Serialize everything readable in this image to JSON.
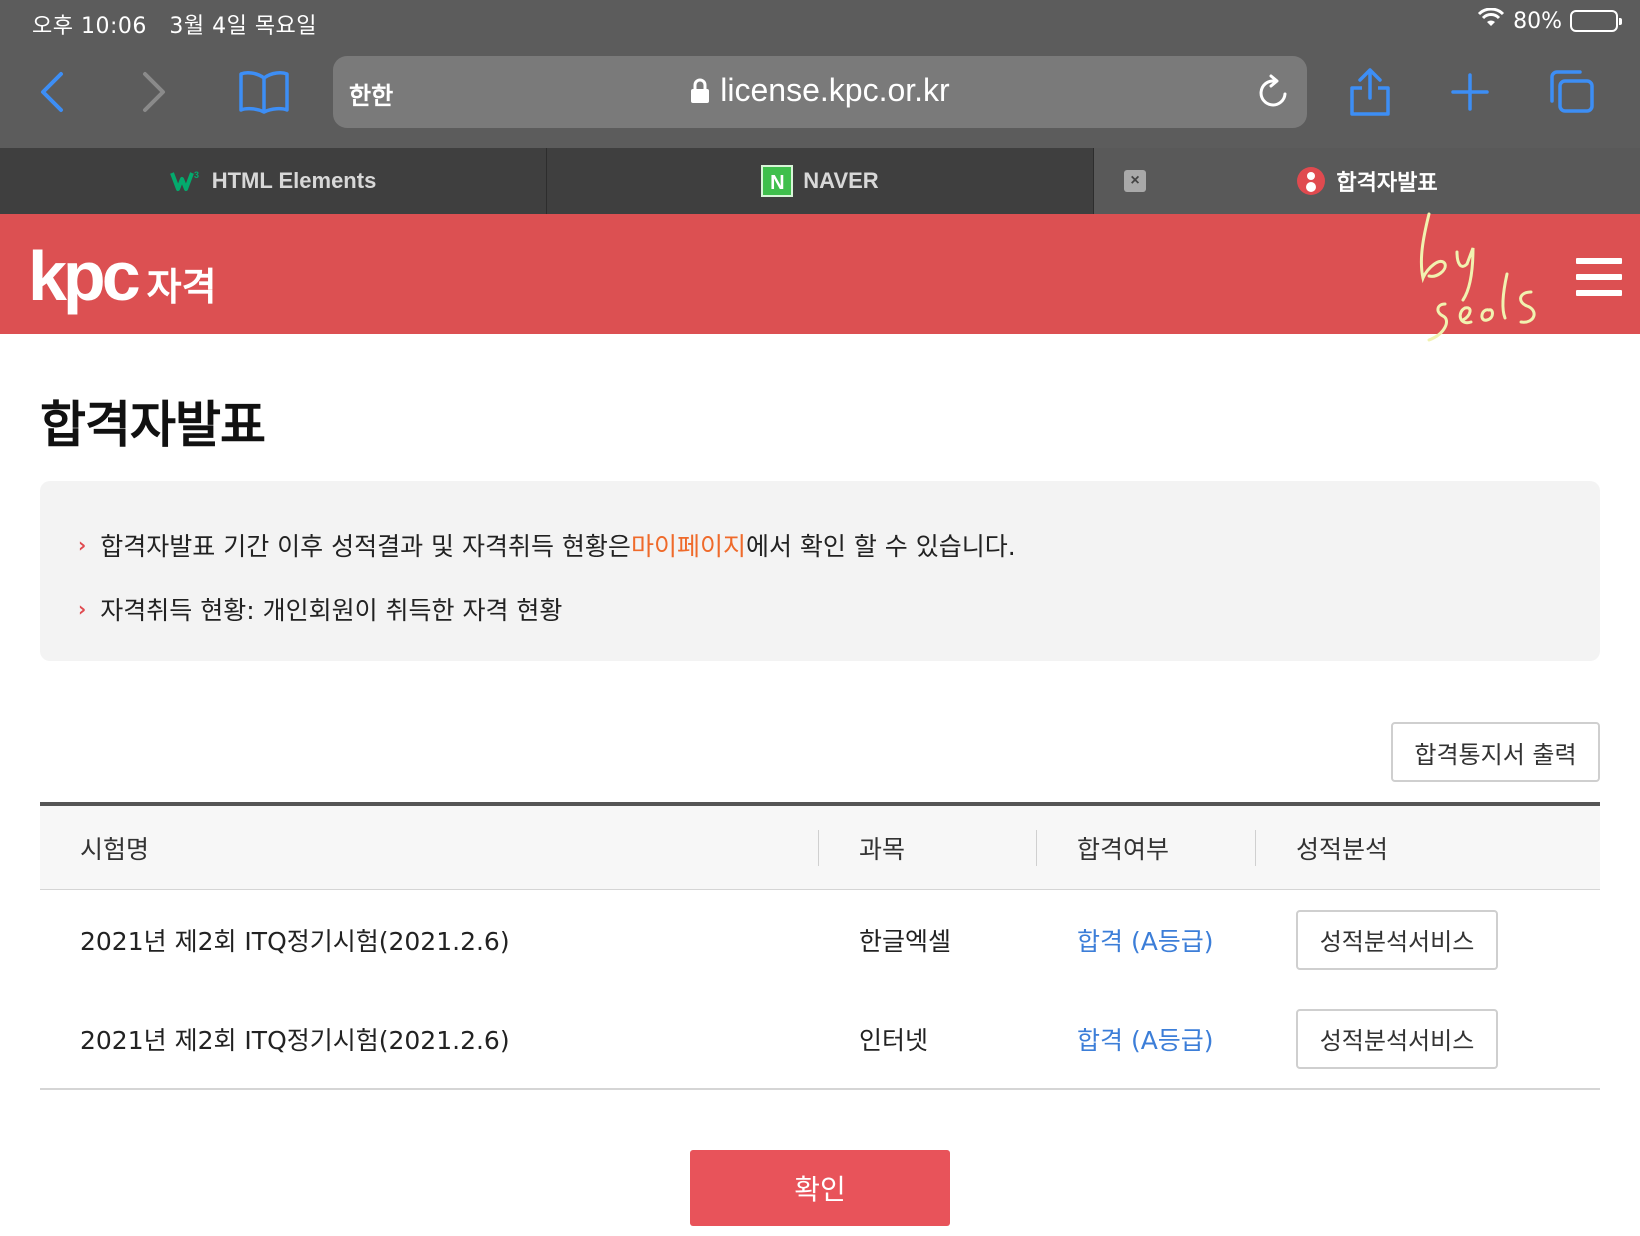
{
  "status_bar": {
    "time": "오후 10:06",
    "date": "3월 4일 목요일",
    "battery": "80%",
    "battery_level": 0.8
  },
  "browser": {
    "reader_label": "한한",
    "url": "license.kpc.or.kr",
    "icons": [
      "back-icon",
      "forward-icon",
      "bookmarks-icon",
      "lock-icon",
      "reload-icon",
      "share-icon",
      "new-tab-icon",
      "tabs-icon"
    ]
  },
  "tabs": [
    {
      "label": "HTML Elements",
      "icon": "w3schools-icon",
      "active": false
    },
    {
      "label": "NAVER",
      "icon": "naver-icon",
      "icon_text": "N",
      "active": false
    },
    {
      "label": "합격자발표",
      "icon": "kpc-favicon-icon",
      "active": true,
      "close_symbol": "×"
    }
  ],
  "site": {
    "logo_main": "kpc",
    "logo_sub": "자격",
    "header_color": "#dc5052"
  },
  "page": {
    "title": "합격자발표",
    "notice": {
      "line1_before": "합격자발표 기간 이후 성적결과 및 자격취득 현황은 ",
      "line1_link": "마이페이지",
      "line1_after": "에서 확인 할 수 있습니다.",
      "line2": "자격취득 현황: 개인회원이 취득한 자격 현황",
      "bullet": "›"
    },
    "print_button": "합격통지서 출력",
    "table": {
      "headers": [
        "시험명",
        "과목",
        "합격여부",
        "성적분석"
      ],
      "rows": [
        {
          "exam": "2021년 제2회 ITQ정기시험(2021.2.6)",
          "subject": "한글엑셀",
          "result": "합격 (A등급)",
          "action": "성적분석서비스"
        },
        {
          "exam": "2021년 제2회 ITQ정기시험(2021.2.6)",
          "subject": "인터넷",
          "result": "합격 (A등급)",
          "action": "성적분석서비스"
        }
      ]
    },
    "confirm_button": "확인"
  }
}
